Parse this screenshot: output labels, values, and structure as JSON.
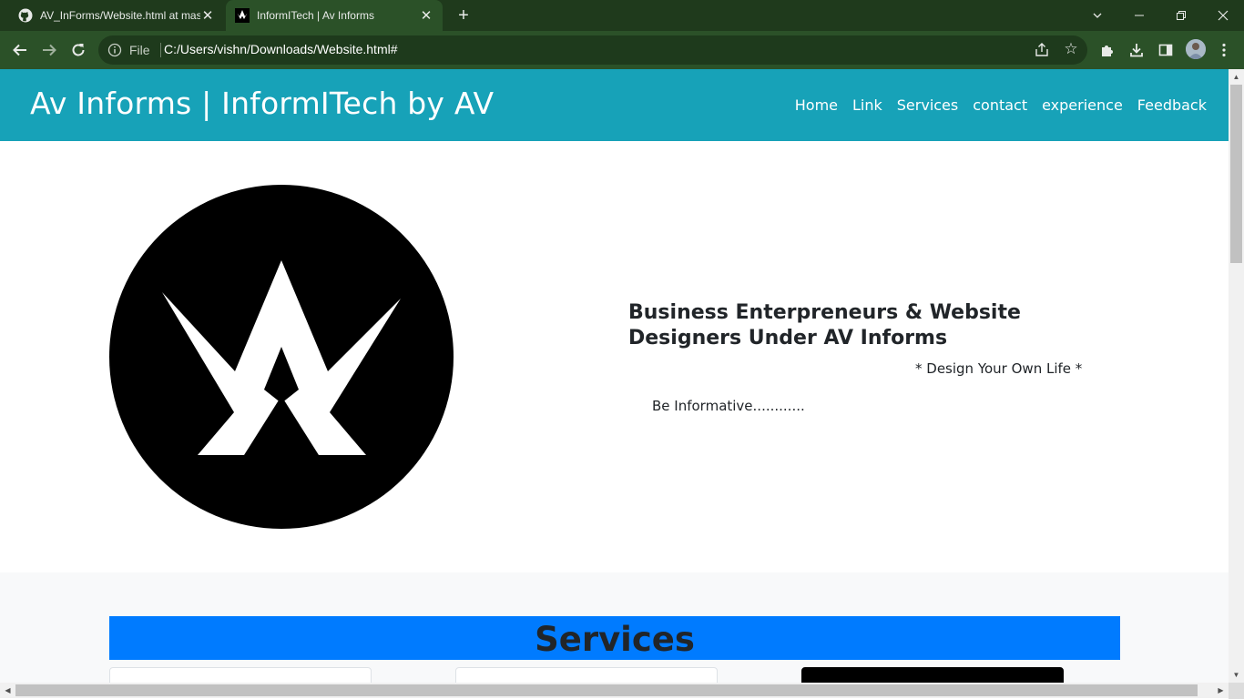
{
  "browser": {
    "tabs": [
      {
        "title": "AV_InForms/Website.html at mas",
        "favicon": "github-icon",
        "active": false
      },
      {
        "title": "InformITech | Av Informs",
        "favicon": "av-logo-icon",
        "active": true
      }
    ],
    "address": {
      "scheme_label": "File",
      "url": "C:/Users/vishn/Downloads/Website.html#"
    },
    "colors": {
      "frame": "#1f3a1c",
      "toolbar": "#2b5128",
      "omnibox": "#1e3a1c"
    }
  },
  "page": {
    "brand": "Av Informs | InformITech by AV",
    "nav": [
      "Home",
      "Link",
      "Services",
      "contact",
      "experience",
      "Feedback"
    ],
    "hero": {
      "title": "Business Enterpreneurs & Website Designers Under AV Informs",
      "tagline": "* Design Your Own Life *",
      "subtitle": "Be Informative............"
    },
    "services": {
      "heading": "Services"
    },
    "colors": {
      "navbar": "#17a2b8",
      "services_banner": "#007bff",
      "section_bg": "#f8f9fa"
    }
  }
}
